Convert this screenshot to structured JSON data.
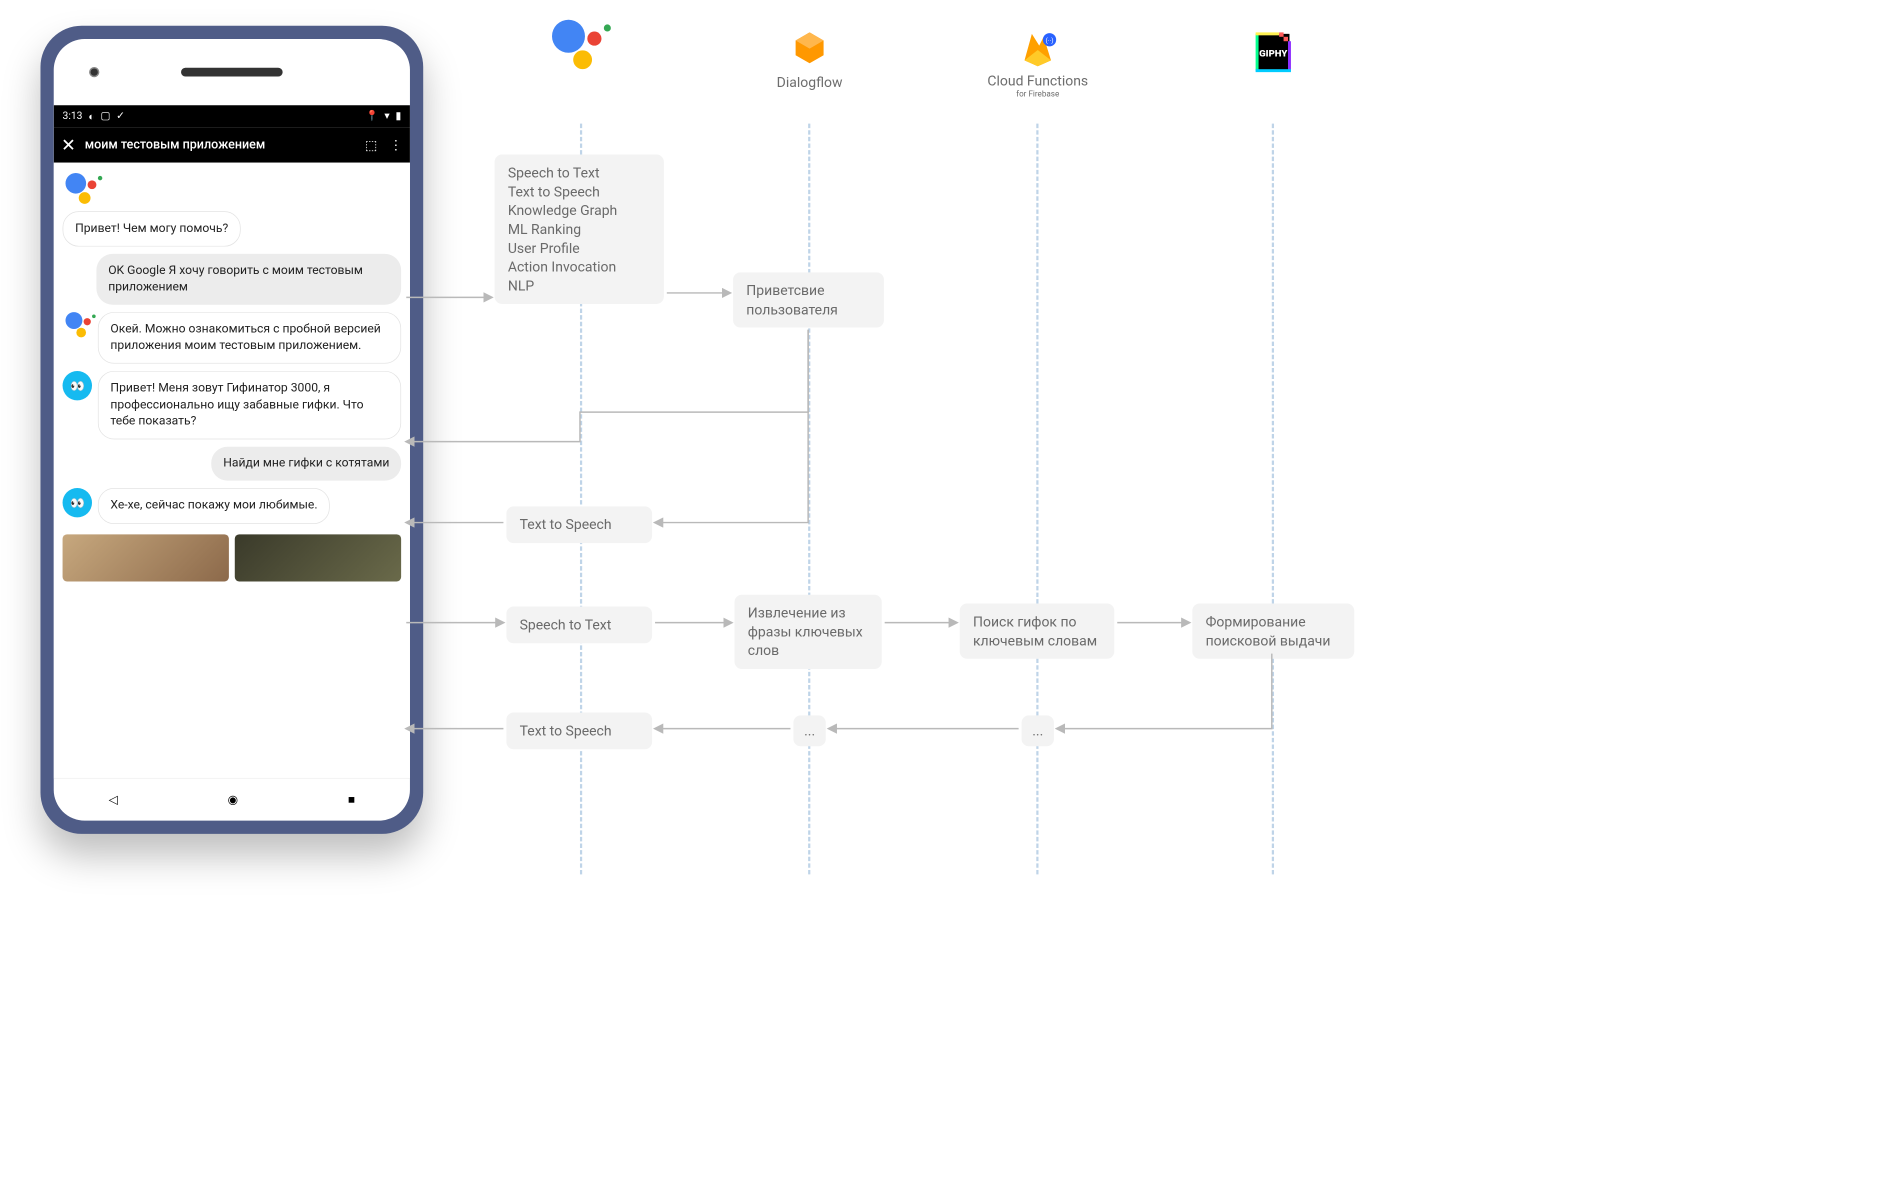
{
  "phone": {
    "time": "3:13",
    "appbar_title": "моим тестовым приложением",
    "msgs": {
      "m1": "Привет! Чем могу помочь?",
      "m2": "OK Google Я хочу говорить с моим тестовым приложением",
      "m3": "Окей. Можно ознакомиться с пробной версией приложения моим тестовым приложением.",
      "m4": "Привет! Меня зовут Гифинатор 3000, я профессионально ищу забавные гифки. Что тебе показать?",
      "m5": "Найди мне гифки с котятами",
      "m6": "Хе-хе, сейчас покажу мои любимые."
    }
  },
  "columns": {
    "dialogflow": "Dialogflow",
    "cloudfn": "Cloud Functions",
    "cloudfn_sub": "for Firebase",
    "giphy": "GIPHY"
  },
  "boxes": {
    "ga_caps": [
      "Speech to Text",
      "Text to Speech",
      "Knowledge Graph",
      "ML Ranking",
      "User Profile",
      "Action Invocation",
      "NLP"
    ],
    "welcome": "Приветсвие пользователя",
    "tts1": "Text to Speech",
    "stt1": "Speech to Text",
    "extract": "Извлечение из фразы ключевых слов",
    "search": "Поиск гифок по ключевым словам",
    "form": "Формирование поисковой выдачи",
    "tts2": "Text to Speech",
    "dotL": "...",
    "dotR": "..."
  }
}
